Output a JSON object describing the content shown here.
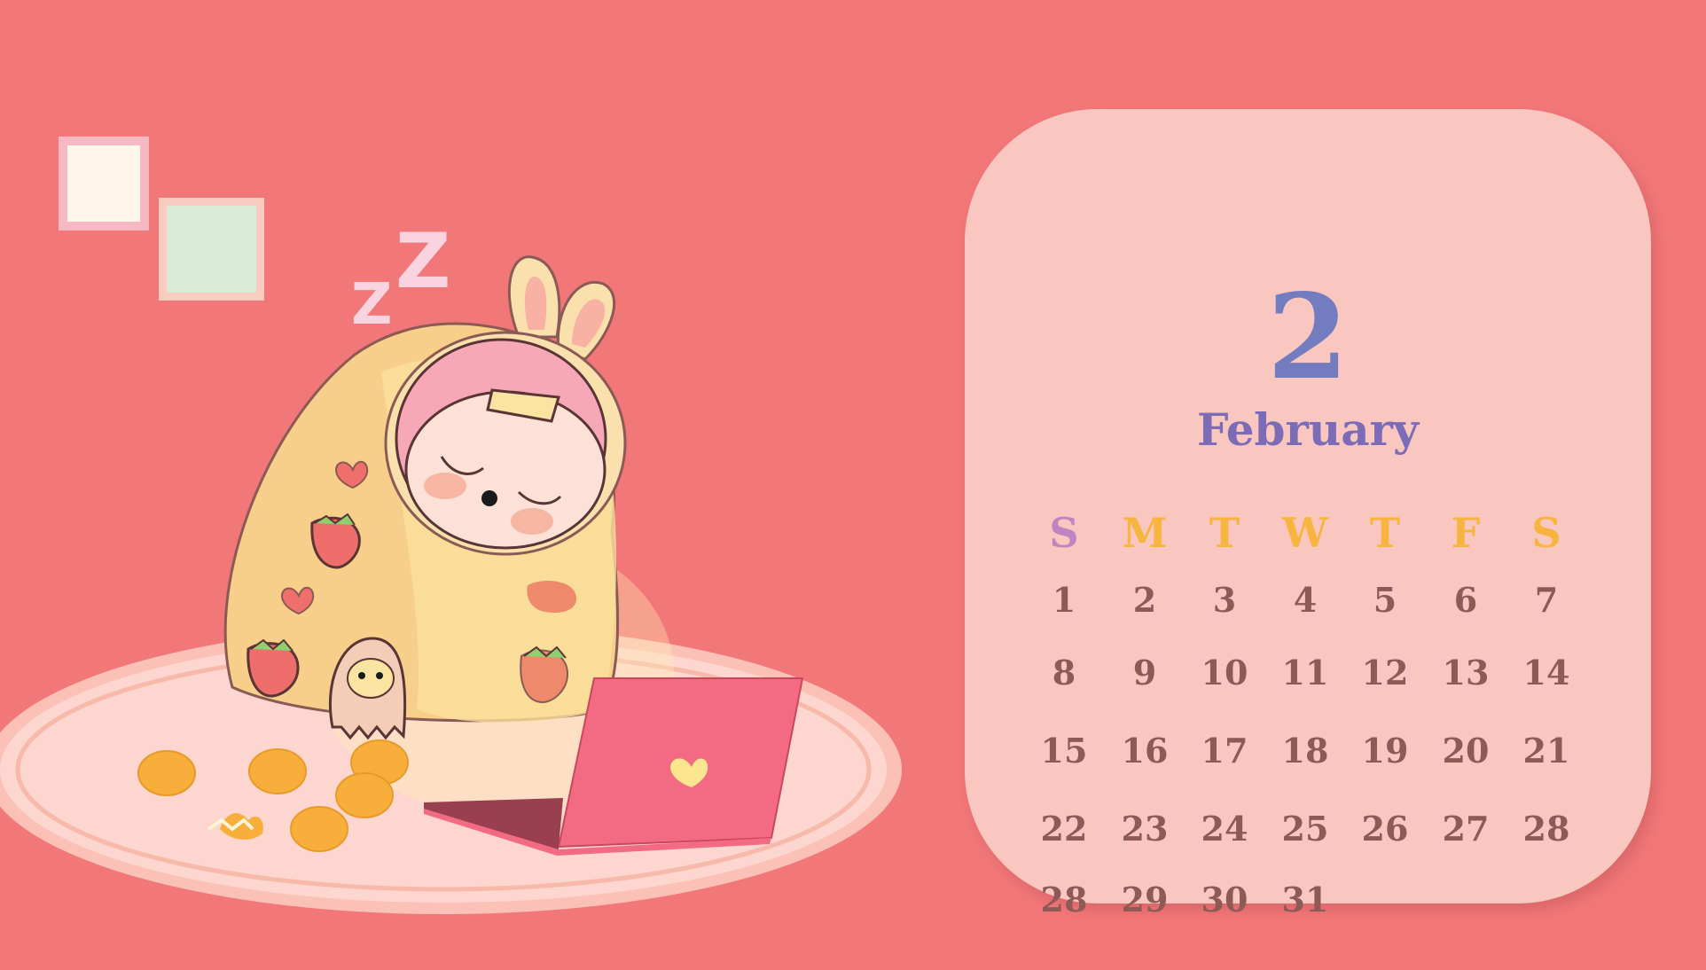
{
  "calendar": {
    "month_number": "2",
    "month_name": "February",
    "weekdays": [
      {
        "label": "S",
        "color": "#c084c0"
      },
      {
        "label": "M",
        "color": "#f7b53f"
      },
      {
        "label": "T",
        "color": "#f7b53f"
      },
      {
        "label": "W",
        "color": "#f7b53f"
      },
      {
        "label": "T",
        "color": "#f7b53f"
      },
      {
        "label": "F",
        "color": "#f7b53f"
      },
      {
        "label": "S",
        "color": "#f7b53f"
      }
    ],
    "weeks": [
      [
        "1",
        "2",
        "3",
        "4",
        "5",
        "6",
        "7"
      ],
      [
        "8",
        "9",
        "10",
        "11",
        "12",
        "13",
        "14"
      ],
      [
        "15",
        "16",
        "17",
        "18",
        "19",
        "20",
        "21"
      ],
      [
        "22",
        "23",
        "24",
        "25",
        "26",
        "27",
        "28"
      ],
      [
        "28",
        "29",
        "30",
        "31"
      ]
    ]
  },
  "illustration": {
    "sleep_letters": [
      "Z",
      "Z"
    ]
  },
  "colors": {
    "background": "#f27779",
    "card": "#f9c6c0",
    "month_number": "#727cbf",
    "month_name": "#7c6bb6",
    "day_number": "#8d5a56",
    "laptop": "#f26b82"
  }
}
